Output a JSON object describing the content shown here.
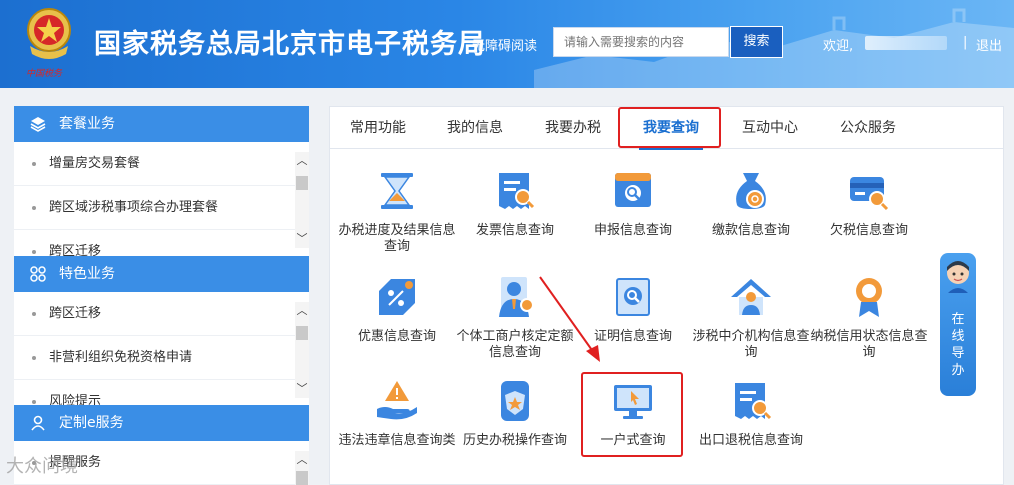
{
  "header": {
    "site_title": "国家税务总局北京市电子税务局",
    "emblem_text": "中国税务",
    "accessibility": "无障碍阅读",
    "search_placeholder": "请输入需要搜索的内容",
    "search_button": "搜索",
    "welcome": "欢迎,",
    "separator": "|",
    "logout": "退出"
  },
  "sidebar": {
    "sections": [
      {
        "title": "套餐业务",
        "icon": "layers-icon",
        "items": [
          "增量房交易套餐",
          "跨区域涉税事项综合办理套餐",
          "跨区迁移"
        ]
      },
      {
        "title": "特色业务",
        "icon": "grid-icon",
        "items": [
          "跨区迁移",
          "非营利组织免税资格申请",
          "风险提示"
        ]
      },
      {
        "title": "定制e服务",
        "icon": "user-icon",
        "items": [
          "提醒服务"
        ]
      }
    ]
  },
  "tabs": [
    "常用功能",
    "我的信息",
    "我要办税",
    "我要查询",
    "互动中心",
    "公众服务"
  ],
  "active_tab": "我要查询",
  "grid_items": [
    {
      "label": "办税进度及结果信息查询",
      "icon": "hourglass-icon"
    },
    {
      "label": "发票信息查询",
      "icon": "invoice-search-icon"
    },
    {
      "label": "申报信息查询",
      "icon": "declaration-search-icon"
    },
    {
      "label": "缴款信息查询",
      "icon": "money-bag-icon"
    },
    {
      "label": "欠税信息查询",
      "icon": "card-search-icon"
    },
    {
      "label": "优惠信息查询",
      "icon": "discount-tag-icon"
    },
    {
      "label": "个体工商户核定定额信息查询",
      "icon": "business-person-icon"
    },
    {
      "label": "证明信息查询",
      "icon": "certificate-search-icon"
    },
    {
      "label": "涉税中介机构信息查询",
      "icon": "agency-house-icon"
    },
    {
      "label": "纳税信用状态信息查询",
      "icon": "credit-medal-icon"
    },
    {
      "label": "违法违章信息查询类",
      "icon": "warning-hand-icon"
    },
    {
      "label": "历史办税操作查询",
      "icon": "history-shield-icon"
    },
    {
      "label": "一户式查询",
      "icon": "monitor-cursor-icon"
    },
    {
      "label": "出口退税信息查询",
      "icon": "export-refund-icon"
    }
  ],
  "online_guide": "在线导办",
  "watermark": "大众问境",
  "colors": {
    "header_blue": "#2a86e6",
    "section_blue": "#3a8ee6",
    "highlight_red": "#e02020",
    "active_tab": "#1a6fd0"
  }
}
